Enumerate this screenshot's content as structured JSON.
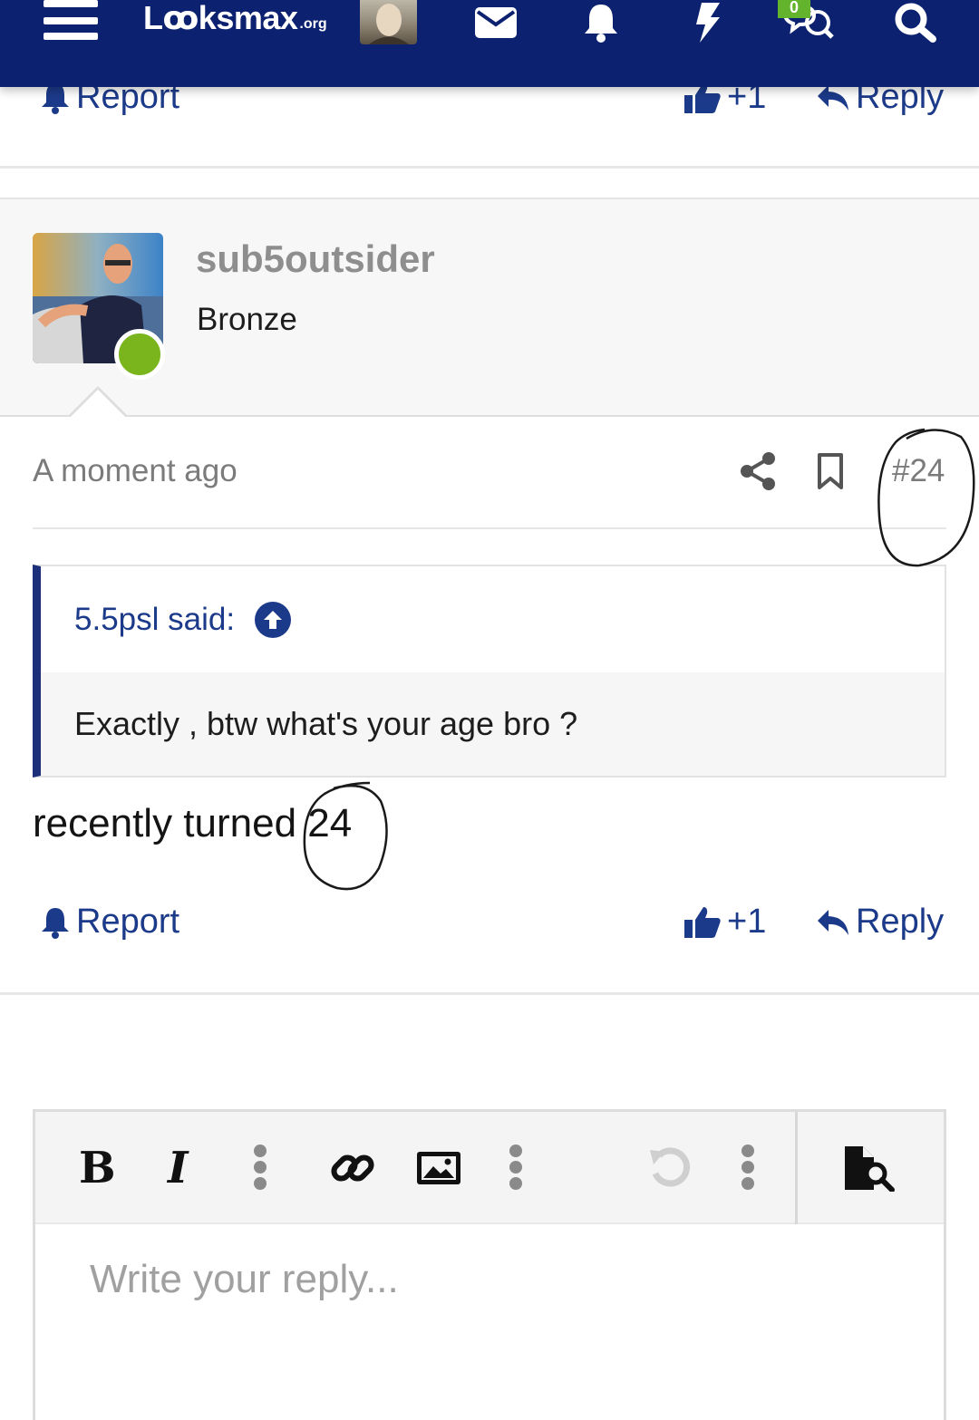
{
  "topbar": {
    "logo_main": "Lꝏksmax",
    "logo_tld": ".org",
    "conversations_badge": "0",
    "icons": [
      "menu-icon",
      "avatar",
      "envelope-icon",
      "bell-icon",
      "bolt-icon",
      "conversations-icon",
      "search-icon"
    ]
  },
  "previous_post": {
    "report_label": "Report",
    "like_count": "+1",
    "reply_label": "Reply"
  },
  "post": {
    "author": "sub5outsider",
    "user_title": "Bronze",
    "timestamp": "A moment ago",
    "post_number": "#24",
    "quote": {
      "author_said": "5.5psl said:",
      "text": "Exactly , btw what's your age bro ?"
    },
    "message_prefix": "recently turned ",
    "message_highlight": "24",
    "actions": {
      "report_label": "Report",
      "like_count": "+1",
      "reply_label": "Reply"
    }
  },
  "editor": {
    "placeholder": "Write your reply...",
    "bold_label": "B",
    "italic_label": "I"
  },
  "colors": {
    "nav_bg": "#0c2170",
    "link": "#1c3a8a",
    "online": "#7ab51d",
    "badge": "#64b32c"
  }
}
